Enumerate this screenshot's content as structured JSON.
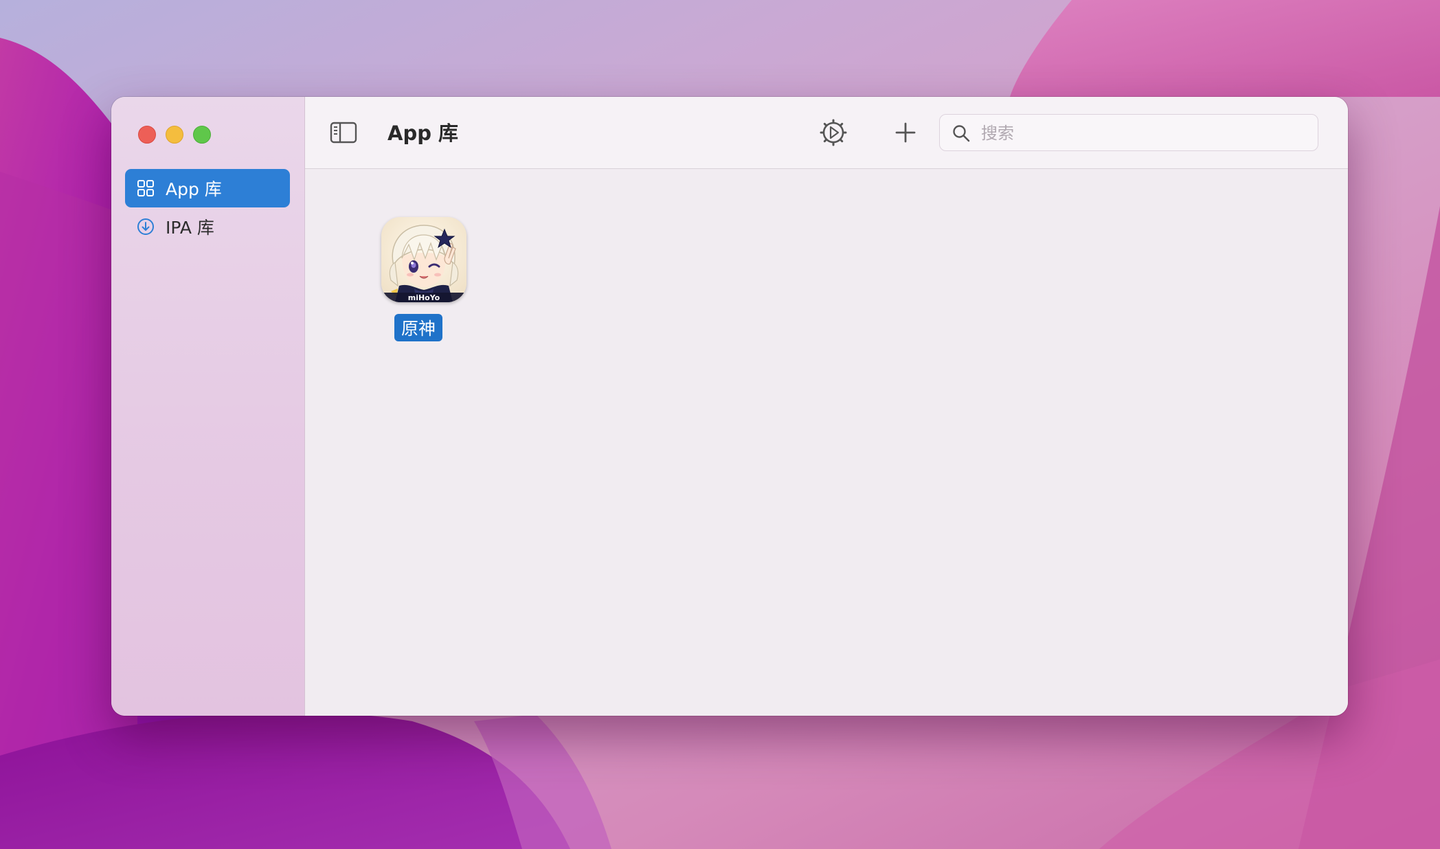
{
  "window": {
    "title": "App 库"
  },
  "traffic_lights": [
    "close",
    "minimize",
    "zoom"
  ],
  "sidebar": {
    "items": [
      {
        "label": "App 库",
        "icon": "grid-icon",
        "selected": true
      },
      {
        "label": "IPA 库",
        "icon": "download-circle-icon",
        "selected": false
      }
    ]
  },
  "toolbar": {
    "icons": [
      "sidebar-toggle-icon",
      "gear-icon",
      "plus-icon",
      "grid-view-icon",
      "list-view-icon"
    ],
    "active_view": "grid"
  },
  "search": {
    "placeholder": "搜索",
    "value": ""
  },
  "apps": [
    {
      "name": "原神",
      "icon_text": "miHoYo",
      "selected": true
    }
  ],
  "colors": {
    "accent": "#2d7fd6",
    "close": "#ed5f57",
    "minimize": "#f4bd3e",
    "zoom": "#5fc74a"
  }
}
